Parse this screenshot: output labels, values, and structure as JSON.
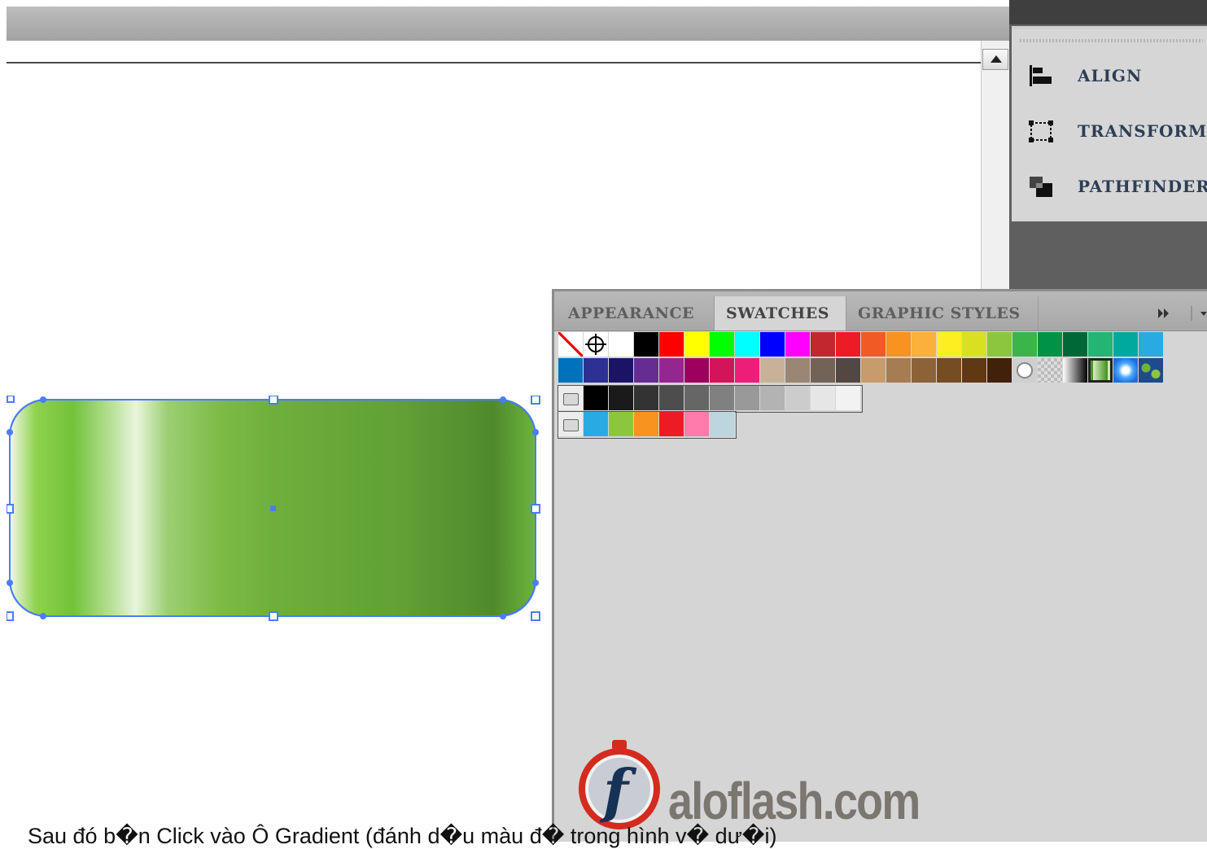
{
  "dock": {
    "items": [
      {
        "label": "ALIGN",
        "icon": "align-icon"
      },
      {
        "label": "TRANSFORM",
        "icon": "transform-icon"
      },
      {
        "label": "PATHFINDER",
        "icon": "pathfinder-icon"
      }
    ]
  },
  "swatches_panel": {
    "tabs": [
      {
        "label": "APPEARANCE",
        "active": false
      },
      {
        "label": "SWATCHES",
        "active": true
      },
      {
        "label": "GRAPHIC STYLES",
        "active": false
      }
    ],
    "menu_icon": "panel-menu-icon",
    "rows": [
      {
        "name": "row-1",
        "colors": [
          "none",
          "registration",
          "#ffffff",
          "#000000",
          "#ff0000",
          "#ffff00",
          "#00ff00",
          "#00ffff",
          "#0000ff",
          "#ff00ff",
          "#c1272d",
          "#ed1c24",
          "#f15a24",
          "#f7931e",
          "#fbb03b",
          "#fcee21",
          "#d9e021",
          "#8cc63f",
          "#39b54a",
          "#009245",
          "#006837",
          "#22b573",
          "#00a99d",
          "#29abe2"
        ]
      },
      {
        "name": "row-2",
        "colors": [
          "#0071bc",
          "#2e3192",
          "#1b1464",
          "#662d91",
          "#93278f",
          "#9e005d",
          "#d4145a",
          "#ed1e79",
          "#c7b299",
          "#998675",
          "#736357",
          "#534741",
          "#c69c6d",
          "#a67c52",
          "#8c6239",
          "#754c24",
          "#603813",
          "#42210b",
          "pattern-dots",
          "pattern-checker",
          "gradient-black",
          "gradient-green",
          "gradient-blue",
          "pattern-leaf"
        ]
      },
      {
        "name": "gray-group",
        "colors": [
          "folder",
          "#000000",
          "#1a1a1a",
          "#333333",
          "#4d4d4d",
          "#666666",
          "#808080",
          "#999999",
          "#b3b3b3",
          "#cccccc",
          "#e6e6e6",
          "#f2f2f2"
        ]
      },
      {
        "name": "bright-group",
        "colors": [
          "folder",
          "#29abe2",
          "#8cc63f",
          "#f7931e",
          "#ed1c24",
          "#ff7bac",
          "#bcd6df"
        ]
      }
    ]
  },
  "logo": {
    "text": "aloflash.com",
    "letter": "f"
  },
  "caption": "Sau đó b�n Click vào Ô Gradient (đánh d�u màu đ� trong hình v� dư�i)"
}
